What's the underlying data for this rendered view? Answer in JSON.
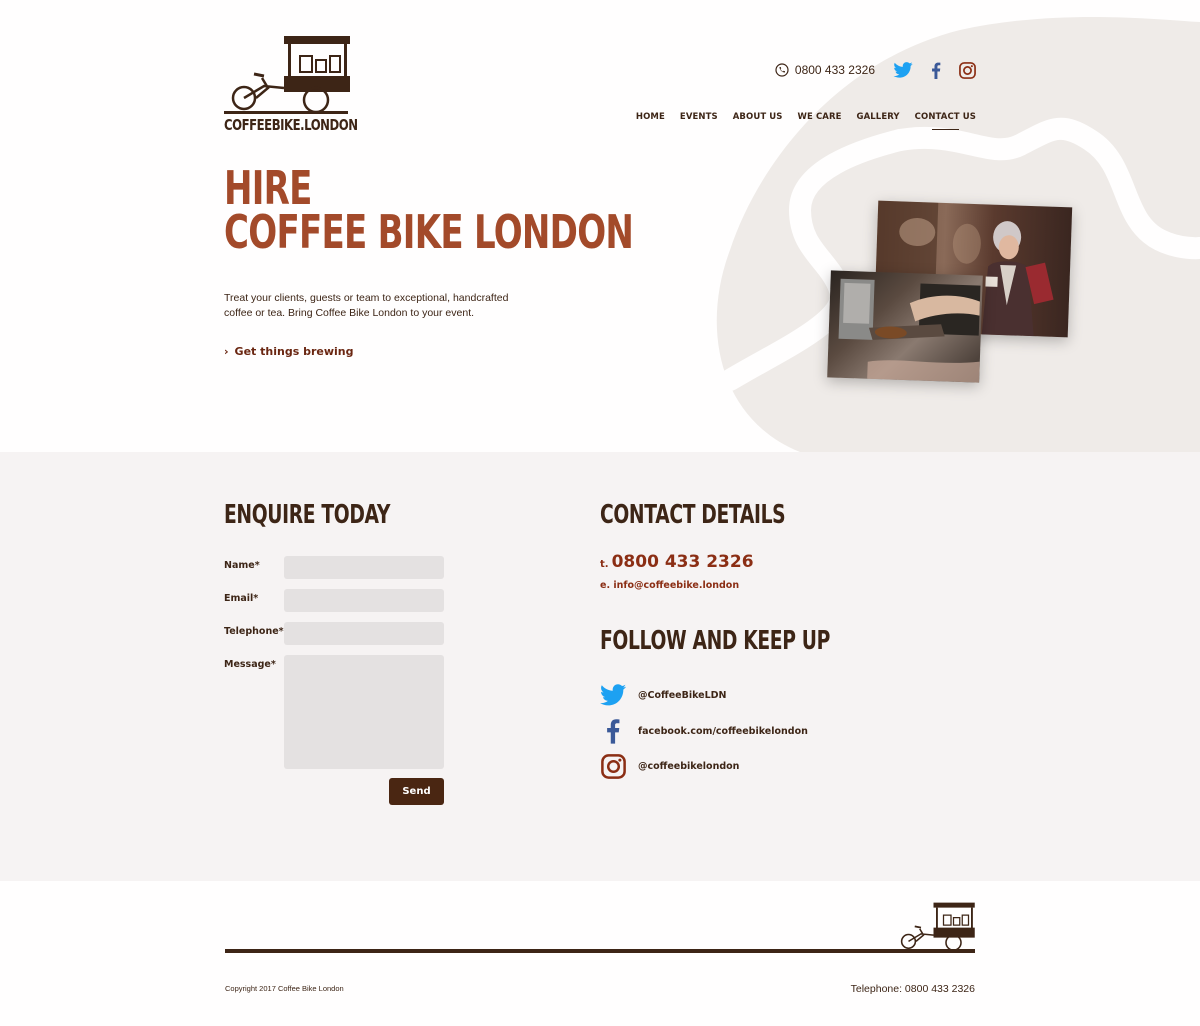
{
  "brand": {
    "logo_text": "COFFEEBIKE.LONDON"
  },
  "header": {
    "phone": "0800 433 2326",
    "social_icons": [
      "twitter-icon",
      "facebook-icon",
      "instagram-icon"
    ]
  },
  "nav": {
    "items": [
      {
        "label": "HOME"
      },
      {
        "label": "EVENTS"
      },
      {
        "label": "ABOUT US"
      },
      {
        "label": "WE CARE"
      },
      {
        "label": "GALLERY"
      },
      {
        "label": "CONTACT US",
        "active": true
      }
    ]
  },
  "hero": {
    "title_line1": "HIRE",
    "title_line2": "COFFEE BIKE LONDON",
    "copy": "Treat your clients, guests or team to exceptional, handcrafted coffee or tea. Bring Coffee Bike London to your event.",
    "cta_arrow": "›",
    "cta": "Get things brewing"
  },
  "enquire": {
    "heading": "ENQUIRE TODAY",
    "fields": [
      {
        "label": "Name*"
      },
      {
        "label": "Email*"
      },
      {
        "label": "Telephone*"
      },
      {
        "label": "Message*"
      }
    ],
    "send_label": "Send"
  },
  "contact": {
    "heading": "CONTACT DETAILS",
    "phone_prefix": "t.",
    "phone": "0800 433 2326",
    "email": "e. info@coffeebike.london"
  },
  "follow": {
    "heading": "FOLLOW AND KEEP UP",
    "items": [
      {
        "icon": "twitter-icon",
        "text": "@CoffeeBikeLDN"
      },
      {
        "icon": "facebook-icon",
        "text": "facebook.com/coffeebikelondon"
      },
      {
        "icon": "instagram-icon",
        "text": "@coffeebikelondon"
      }
    ]
  },
  "footer": {
    "copyright": "Copyright 2017 Coffee Bike London",
    "telephone": "Telephone: 0800 433 2326"
  },
  "colors": {
    "brand_dark": "#3d2516",
    "accent_rust": "#a34a2a",
    "accent_deep": "#8b2e14",
    "twitter": "#1da1f2",
    "facebook": "#3b5998",
    "instagram": "#8b2e14",
    "section_bg": "#f6f3f3",
    "blob": "#efebe8"
  }
}
